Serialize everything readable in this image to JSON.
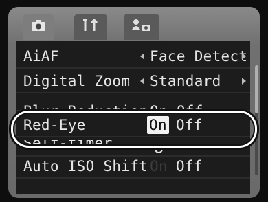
{
  "tabs": [
    {
      "icon": "camera-icon",
      "active": true
    },
    {
      "icon": "tools-icon",
      "active": false
    },
    {
      "icon": "my-menu-icon",
      "active": false
    }
  ],
  "menu": {
    "rows": [
      {
        "label": "AiAF",
        "value": "Face Detect"
      },
      {
        "label": "Digital Zoom",
        "value": "Standard"
      },
      {
        "label": "Blur Reduction",
        "value": "On Off"
      },
      {
        "label": "Red-Eye",
        "on": "On",
        "off": "Off",
        "selected": "On"
      },
      {
        "label": "Self-timer",
        "value": "self-timer-icon"
      },
      {
        "label": "Auto ISO Shift",
        "on": "On",
        "off": "Off",
        "selected": "Off"
      }
    ]
  },
  "colors": {
    "highlight": "#ffffff",
    "background": "#1c1c1c"
  }
}
